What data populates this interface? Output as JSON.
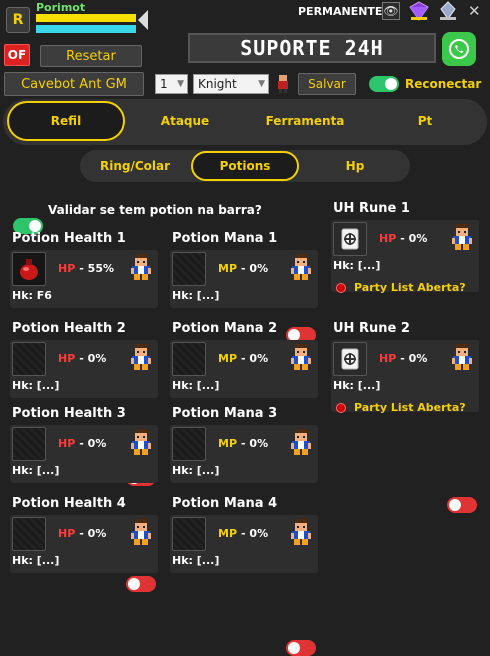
{
  "header": {
    "r_button": "R",
    "character_name": "Porimot",
    "license_label": "PERMANENTE",
    "suporte_label": "SUPORTE 24H"
  },
  "controls": {
    "of_button": "OF",
    "reset_button": "Resetar",
    "cavebot_button": "Cavebot Ant GM",
    "slot_select_value": "1",
    "vocation_select_value": "Knight",
    "save_button": "Salvar",
    "reconnect_label": "Reconectar"
  },
  "tabs": [
    {
      "label": "Refil",
      "active": true
    },
    {
      "label": "Ataque",
      "active": false
    },
    {
      "label": "Ferramenta",
      "active": false
    },
    {
      "label": "Pt",
      "active": false
    }
  ],
  "subtabs": [
    {
      "label": "Ring/Colar",
      "active": false
    },
    {
      "label": "Potions",
      "active": true
    },
    {
      "label": "Hp",
      "active": false
    }
  ],
  "validate_label": "Validar se tem potion na barra?",
  "health_potions": [
    {
      "title": "Potion Health 1",
      "stat": "HP",
      "value": "- 55%",
      "hk": "Hk: F6",
      "has_item": true
    },
    {
      "title": "Potion Health 2",
      "stat": "HP",
      "value": "- 0%",
      "hk": "Hk: [...]",
      "has_item": false
    },
    {
      "title": "Potion Health 3",
      "stat": "HP",
      "value": "- 0%",
      "hk": "Hk: [...]",
      "has_item": false
    },
    {
      "title": "Potion Health 4",
      "stat": "HP",
      "value": "- 0%",
      "hk": "Hk: [...]",
      "has_item": false
    }
  ],
  "mana_potions": [
    {
      "title": "Potion Mana 1",
      "stat": "MP",
      "value": "- 0%",
      "hk": "Hk: [...]"
    },
    {
      "title": "Potion Mana 2",
      "stat": "MP",
      "value": "- 0%",
      "hk": "Hk: [...]"
    },
    {
      "title": "Potion Mana 3",
      "stat": "MP",
      "value": "- 0%",
      "hk": "Hk: [...]"
    },
    {
      "title": "Potion Mana 4",
      "stat": "MP",
      "value": "- 0%",
      "hk": "Hk: [...]"
    }
  ],
  "uh_runes": [
    {
      "title": "UH Rune 1",
      "stat": "HP",
      "value": "- 0%",
      "hk": "Hk: [...]",
      "party": "Party List Aberta?"
    },
    {
      "title": "UH Rune 2",
      "stat": "HP",
      "value": "- 0%",
      "hk": "Hk: [...]",
      "party": "Party List Aberta?"
    }
  ],
  "colors": {
    "accent": "#f5d000",
    "toggle_on": "#2ec46c",
    "toggle_off": "#e03434",
    "hp": "#ff3a3a"
  }
}
